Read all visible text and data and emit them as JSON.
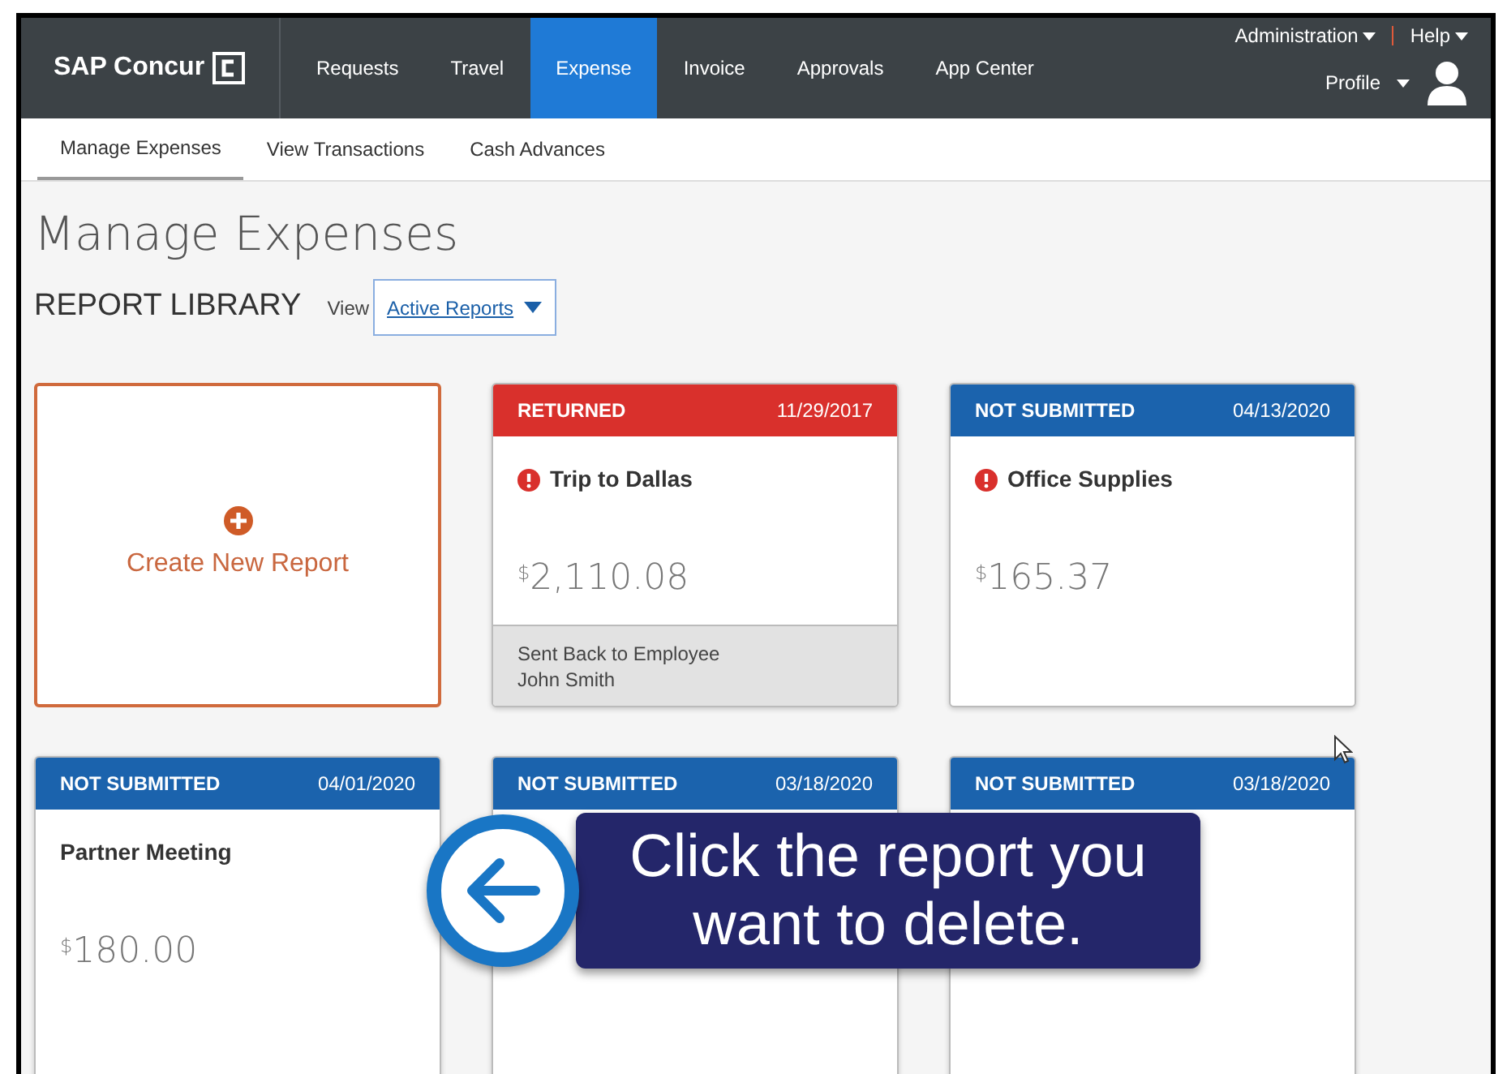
{
  "nav": {
    "logo": "SAP Concur",
    "items": [
      {
        "label": "Requests",
        "selected": false
      },
      {
        "label": "Travel",
        "selected": false
      },
      {
        "label": "Expense",
        "selected": true
      },
      {
        "label": "Invoice",
        "selected": false
      },
      {
        "label": "Approvals",
        "selected": false
      },
      {
        "label": "App Center",
        "selected": false
      }
    ],
    "admin": "Administration",
    "help": "Help",
    "profile": "Profile"
  },
  "subnav": [
    {
      "label": "Manage Expenses",
      "selected": true
    },
    {
      "label": "View Transactions",
      "selected": false
    },
    {
      "label": "Cash Advances",
      "selected": false
    }
  ],
  "page_title": "Manage Expenses",
  "library": {
    "title": "REPORT LIBRARY",
    "view_label": "View",
    "view_value": "Active Reports"
  },
  "create_card": {
    "label": "Create New Report"
  },
  "reports": [
    {
      "kind": "returned",
      "status": "RETURNED",
      "date": "11/29/2017",
      "title": "Trip to Dallas",
      "warning": true,
      "currency": "$",
      "amount": "2,110.08",
      "footer": [
        "Sent Back to Employee",
        "John Smith"
      ]
    },
    {
      "kind": "not_submitted",
      "status": "NOT SUBMITTED",
      "date": "04/13/2020",
      "title": "Office Supplies",
      "warning": true,
      "currency": "$",
      "amount": "165.37"
    },
    {
      "kind": "not_submitted",
      "status": "NOT SUBMITTED",
      "date": "04/01/2020",
      "title": "Partner Meeting",
      "warning": false,
      "currency": "$",
      "amount": "180.00"
    },
    {
      "kind": "not_submitted",
      "status": "NOT SUBMITTED",
      "date": "03/18/2020"
    },
    {
      "kind": "not_submitted",
      "status": "NOT SUBMITTED",
      "date": "03/18/2020"
    }
  ],
  "callout": {
    "text": "Click the report you want to delete."
  }
}
